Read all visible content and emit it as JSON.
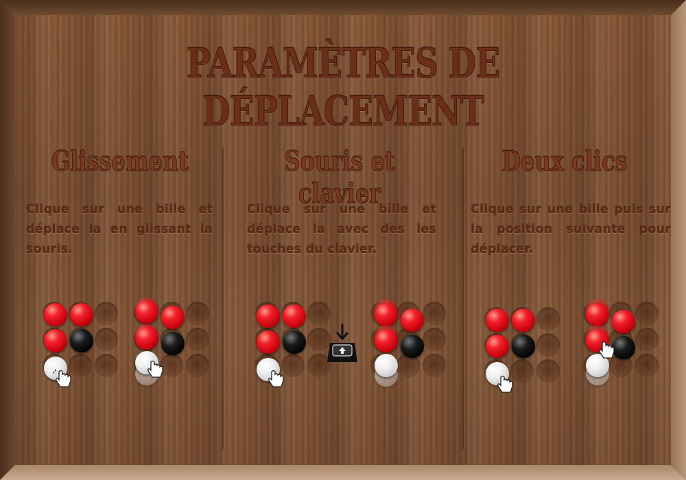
{
  "screen": {
    "title": "PARAMÈTRES DE DÉPLACEMENT"
  },
  "columns": [
    {
      "id": "glissement",
      "title": "Glissement",
      "description": "Clique sur une bille et déplace la en glissant la souris."
    },
    {
      "id": "souris-clavier",
      "title": "Souris et clavier",
      "description": "Clique sur une bille et déplace la avec des les touches du clavier."
    },
    {
      "id": "deux-clics",
      "title": "Deux clics",
      "description": "Clique sur une bille puis sur la position suivante pour déplacer."
    }
  ],
  "ball_colors": {
    "red": "#e0101a",
    "black": "#0a0a0a",
    "white": "#f2f2f2"
  },
  "icons": [
    "pointer-hand-icon",
    "keyboard-key-icon"
  ]
}
